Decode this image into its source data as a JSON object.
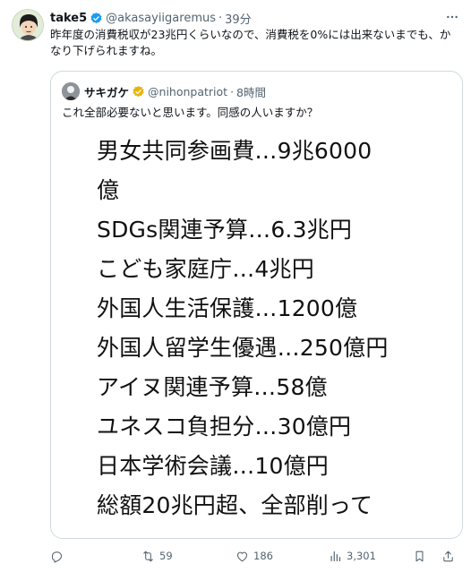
{
  "post": {
    "author_name": "take5",
    "author_handle": "@akasayiigaremus",
    "separator": "·",
    "time": "39分",
    "text": "昨年度の消費税収が23兆円くらいなので、消費税を0%には出来ないまでも、かなり下げられますね。",
    "verified_color": "#1d9bf0"
  },
  "quote": {
    "author_name": "サキガケ",
    "author_handle": "@nihonpatriot",
    "separator": "·",
    "time": "8時間",
    "text": "これ全部必要ないと思います。同感の人いますか？",
    "image_lines": [
      "男女共同参画費…9兆6000",
      "億",
      "SDGs関連予算…6.3兆円",
      "こども家庭庁…4兆円",
      "外国人生活保護…1200億",
      "外国人留学生優遇…250億円",
      "アイヌ関連予算…58億",
      "ユネスコ負担分…30億円",
      "日本学術会議…10億円",
      "総額20兆円超、全部削って"
    ]
  },
  "actions": {
    "reply_count": "",
    "retweet_count": "59",
    "like_count": "186",
    "views_count": "3,301"
  },
  "icons": {
    "more": "more-dots-icon",
    "verified": "verified-badge-icon",
    "reply": "reply-icon",
    "retweet": "retweet-icon",
    "like": "like-icon",
    "views": "views-icon",
    "bookmark": "bookmark-icon",
    "share": "share-icon"
  }
}
